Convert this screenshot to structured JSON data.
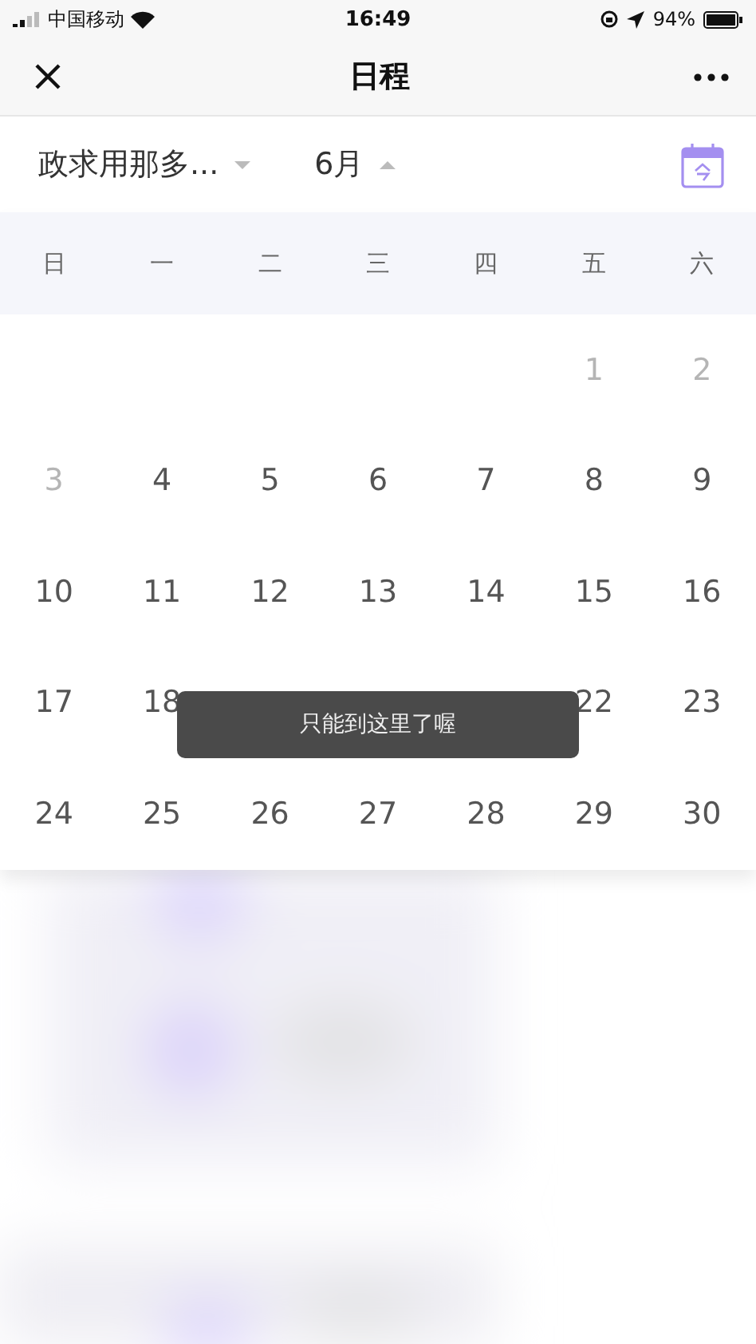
{
  "status_bar": {
    "carrier": "中国移动",
    "time": "16:49",
    "battery": "94%"
  },
  "nav": {
    "title": "日程"
  },
  "filters": [
    {
      "label": "政求用那多...",
      "expanded": false
    },
    {
      "label": "6月",
      "expanded": true
    }
  ],
  "weekdays": [
    "日",
    "一",
    "二",
    "三",
    "四",
    "五",
    "六"
  ],
  "weeks": [
    [
      {
        "day": "1",
        "muted": true
      },
      {
        "day": "2",
        "muted": true
      }
    ],
    [
      {
        "day": "3",
        "muted": true
      },
      {
        "day": "4",
        "muted": false
      },
      {
        "day": "5",
        "muted": false
      },
      {
        "day": "6",
        "muted": false
      },
      {
        "day": "7",
        "muted": false
      },
      {
        "day": "8",
        "muted": false
      },
      {
        "day": "9",
        "muted": false
      }
    ],
    [
      {
        "day": "10",
        "muted": false
      },
      {
        "day": "11",
        "muted": false
      },
      {
        "day": "12",
        "muted": false
      },
      {
        "day": "13",
        "muted": false
      },
      {
        "day": "14",
        "muted": false
      },
      {
        "day": "15",
        "muted": false
      },
      {
        "day": "16",
        "muted": false
      }
    ],
    [
      {
        "day": "17",
        "muted": false
      },
      {
        "day": "18",
        "muted": false
      },
      {
        "kind": "covered"
      },
      {
        "kind": "covered"
      },
      {
        "kind": "covered"
      },
      {
        "day": "22",
        "muted": false
      },
      {
        "day": "23",
        "muted": false
      }
    ],
    [
      {
        "day": "24",
        "muted": false
      },
      {
        "day": "25",
        "muted": false
      },
      {
        "day": "26",
        "muted": false
      },
      {
        "day": "27",
        "muted": false
      },
      {
        "day": "28",
        "muted": false
      },
      {
        "day": "29",
        "muted": false
      },
      {
        "day": "30",
        "muted": false
      }
    ]
  ],
  "toast": "只能到这里了喔"
}
